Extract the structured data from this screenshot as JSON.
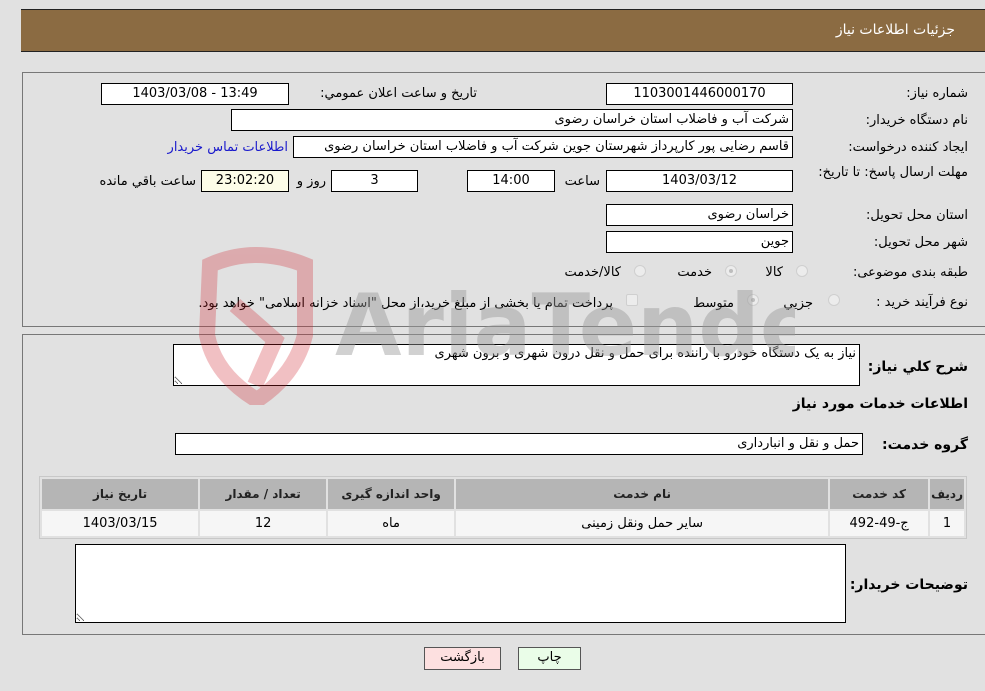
{
  "header": {
    "title": "جزئیات اطلاعات نیاز"
  },
  "form": {
    "need_number": {
      "label": "شماره نیاز:",
      "value": "1103001446000170"
    },
    "announce_datetime": {
      "label": "تاریخ و ساعت اعلان عمومي:",
      "value": "1403/03/08 - 13:49"
    },
    "buyer_org": {
      "label": "نام دستگاه خریدار:",
      "value": "شرکت آب و فاضلاب استان خراسان رضوی"
    },
    "requester": {
      "label": "ایجاد کننده درخواست:",
      "value": "قاسم رضایی پور کارپرداز شهرستان جوین شرکت آب و فاضلاب استان خراسان رضوی"
    },
    "buyer_contact_link": "اطلاعات تماس خریدار",
    "deadline": {
      "label": "مهلت ارسال پاسخ: تا تاریخ:",
      "date": "1403/03/12",
      "time_label": "ساعت",
      "time": "14:00",
      "days": "3",
      "days_label": "روز و",
      "remaining": "23:02:20",
      "remaining_label": "ساعت باقي مانده"
    },
    "delivery_province": {
      "label": "استان محل تحویل:",
      "value": "خراسان رضوی"
    },
    "delivery_city": {
      "label": "شهر محل تحویل:",
      "value": "جوین"
    },
    "category": {
      "label": "طبقه بندی موضوعی:",
      "options": [
        "کالا",
        "خدمت",
        "کالا/خدمت"
      ],
      "selected": "خدمت"
    },
    "purchase_type": {
      "label": "نوع فرآیند خرید :",
      "options": [
        "جزيي",
        "متوسط"
      ],
      "selected": "متوسط",
      "treasury_note": "پرداخت تمام یا بخشی از مبلغ خرید،از محل \"اسناد خزانه اسلامی\" خواهد بود."
    }
  },
  "details": {
    "description_label": "شرح كلي نیاز:",
    "description": "نیاز به یک دستگاه خودرو با راننده برای حمل و نقل درون شهری و برون شهری",
    "services_heading": "اطلاعات خدمات مورد نیاز",
    "service_group_label": "گروه خدمت:",
    "service_group": "حمل و نقل و انبارداری",
    "table": {
      "headers": [
        "ردیف",
        "کد خدمت",
        "نام خدمت",
        "واحد اندازه گیری",
        "تعداد / مقدار",
        "تاریخ نیاز"
      ],
      "rows": [
        [
          "1",
          "ج-49-492",
          "سایر حمل ونقل زمینی",
          "ماه",
          "12",
          "1403/03/15"
        ]
      ]
    },
    "buyer_notes_label": "توضیحات خریدار:",
    "buyer_notes": ""
  },
  "buttons": {
    "print": "چاپ",
    "back": "بازگشت"
  },
  "watermark": {
    "text": "AriaTender.neT"
  },
  "colors": {
    "header": "#8b6b42",
    "print_bg": "#eafde8",
    "back_bg": "#fde0e0",
    "link": "#1a1acc"
  }
}
